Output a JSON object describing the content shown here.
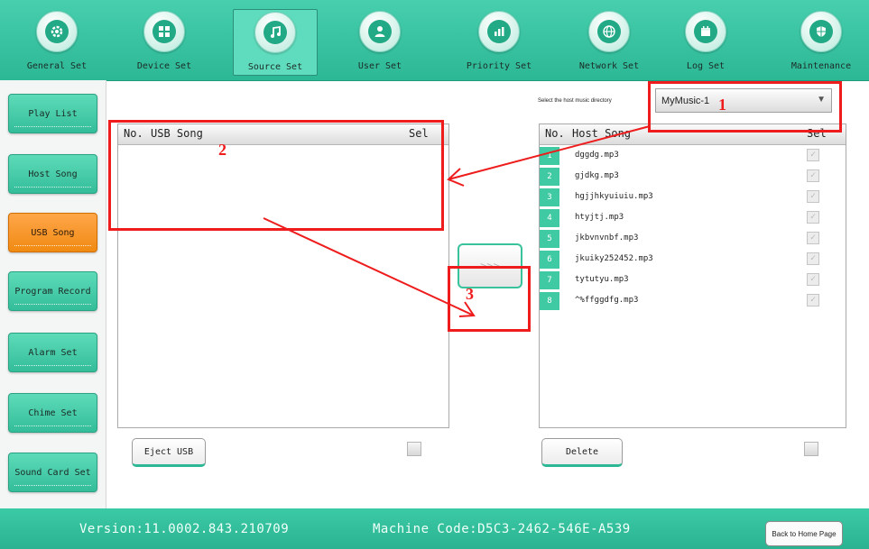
{
  "toolbar": {
    "items": [
      {
        "label": "General Set",
        "icon": "gear-icon"
      },
      {
        "label": "Device Set",
        "icon": "device-grid-icon"
      },
      {
        "label": "Source Set",
        "icon": "music-note-icon"
      },
      {
        "label": "User Set",
        "icon": "user-icon"
      },
      {
        "label": "Priority Set",
        "icon": "bar-chart-icon"
      },
      {
        "label": "Network Set",
        "icon": "globe-icon"
      },
      {
        "label": "Log Set",
        "icon": "calendar-icon"
      },
      {
        "label": "Maintenance",
        "icon": "shield-icon"
      }
    ],
    "active": "Source Set"
  },
  "sidebar": {
    "items": [
      {
        "label": "Play List"
      },
      {
        "label": "Host Song"
      },
      {
        "label": "USB Song"
      },
      {
        "label": "Program Record"
      },
      {
        "label": "Alarm Set"
      },
      {
        "label": "Chime Set"
      },
      {
        "label": "Sound Card Set"
      }
    ],
    "active": "USB Song"
  },
  "usb_panel": {
    "col_no": "No.",
    "col_song": "USB Song",
    "col_sel": "Sel",
    "rows": []
  },
  "host_panel": {
    "directory_label": "Select the host music directory",
    "directory_value": "MyMusic-1",
    "col_no": "No.",
    "col_song": "Host Song",
    "col_sel": "Sel",
    "rows": [
      {
        "no": "1",
        "song": "dggdg.mp3"
      },
      {
        "no": "2",
        "song": "gjdkg.mp3"
      },
      {
        "no": "3",
        "song": "hgjjhkyuiuiu.mp3"
      },
      {
        "no": "4",
        "song": "htyjtj.mp3"
      },
      {
        "no": "5",
        "song": "jkbvnvnbf.mp3"
      },
      {
        "no": "6",
        "song": "jkuiky252452.mp3"
      },
      {
        "no": "7",
        "song": "tytutyu.mp3"
      },
      {
        "no": "8",
        "song": "^%ffggdfg.mp3"
      }
    ],
    "checkmark": "✓"
  },
  "transfer_label": ">>>",
  "buttons": {
    "eject": "Eject USB",
    "delete": "Delete",
    "home": "Back to Home Page"
  },
  "footer": {
    "version": "Version:11.0002.843.210709",
    "machine": "Machine Code:D5C3-2462-546E-A539"
  },
  "annotations": [
    "1",
    "2",
    "3"
  ],
  "colors": {
    "teal": "#2cb795",
    "orange": "#f08a12",
    "annotation_red": "#ee1c1c"
  }
}
